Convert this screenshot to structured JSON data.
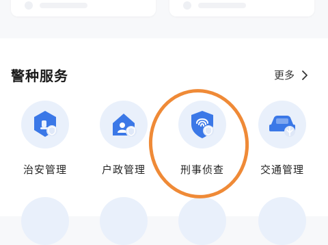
{
  "section": {
    "title": "警种服务",
    "more_label": "更多"
  },
  "services": [
    {
      "label": "治安管理",
      "icon": "public-security-icon"
    },
    {
      "label": "户政管理",
      "icon": "household-registry-icon"
    },
    {
      "label": "刑事侦查",
      "icon": "fingerprint-shield-icon"
    },
    {
      "label": "交通管理",
      "icon": "traffic-car-icon"
    }
  ],
  "colors": {
    "accent": "#3b78e7",
    "icon_bg": "#e9f0fb",
    "highlight": "#ef8a37"
  }
}
